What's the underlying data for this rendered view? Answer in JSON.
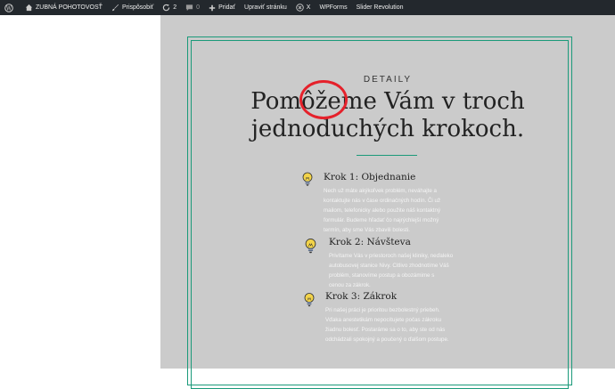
{
  "adminbar": {
    "site_name": "ZUBNÁ POHOTOVOSŤ",
    "customize": "Prispôsobiť",
    "updates_count": "2",
    "comments_count": "0",
    "add_new": "Pridať",
    "edit_page": "Upraviť stránku",
    "x_label": "X",
    "wpforms": "WPForms",
    "slider": "Slider Revolution"
  },
  "section": {
    "eyebrow": "DETAILY",
    "heading_line1": "Pomôžeme Vám v troch",
    "heading_line2": "jednoduchých krokoch."
  },
  "steps": [
    {
      "title": "Krok 1: Objednanie",
      "lines": [
        "Nech už máte akýkoľvek problém, neváhajte a",
        "kontaktujte nás v čase ordinačných hodín. Či už",
        "mailom, telefonicky alebo použite náš kontaktný",
        "formulár. Budeme hľadať čo najrýchlejší možný",
        "termín, aby sme Vás zbavili bolesti."
      ]
    },
    {
      "title": "Krok 2: Návšteva",
      "lines": [
        "Privítame Vás v priestoroch našej kliniky, neďaleko",
        "autobusovej stanice Nivy. Citlivo zhodnotíme Váš",
        "problém, stanovíme postup a obozámime s",
        "cenou za zákrok."
      ]
    },
    {
      "title": "Krok 3: Zákrok",
      "lines": [
        "Pri našej práci je prioritou bezbolestný priebeh.",
        "Vďaka anestetikám nepocítujete počas zákroku",
        "žiadnu bolesť. Postaráme sa o to, aby ste od nás",
        "odchádzali spokojný a poučený o ďalšom postupe."
      ]
    }
  ],
  "colors": {
    "adminbar_bg": "#23282d",
    "accent": "#1b9a7a",
    "annotation": "#e5212b",
    "panel_bg": "#cbcbcb"
  },
  "icons": [
    "wordpress-icon",
    "home-icon",
    "brush-icon",
    "updates-icon",
    "comment-icon",
    "plus-icon",
    "close-icon",
    "lightbulb-icon"
  ]
}
